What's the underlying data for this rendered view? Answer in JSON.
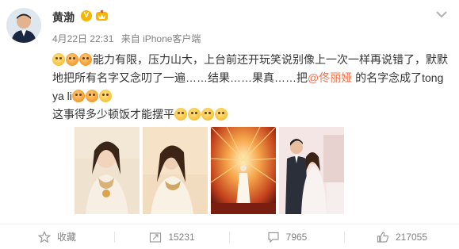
{
  "post": {
    "author": "黄渤",
    "date": "4月22日 22:31",
    "source": "来自 iPhone客户端",
    "verified_mark": "V",
    "text": {
      "line1": "能力有限，压力山大，上台前还开玩笑说别像上一次一样再说错了，默默地把所有名字又念叨了一遍……结果……果真……把",
      "mention": "@佟丽娅",
      "line1_tail": " 的名字念成了tong ya li",
      "line2": "这事得多少顿饭才能摆平"
    }
  },
  "actions": {
    "favorite": "收藏",
    "repost": "15231",
    "comment": "7965",
    "like": "217055"
  },
  "icons": {
    "avatar": "avatar",
    "more": "chevron-down-icon",
    "favorite": "star-icon",
    "repost": "repost-icon",
    "comment": "comment-icon",
    "like": "thumbs-up-icon"
  },
  "colors": {
    "mention": "#eb7350",
    "meta": "#808080",
    "verified": "#f8b500"
  }
}
